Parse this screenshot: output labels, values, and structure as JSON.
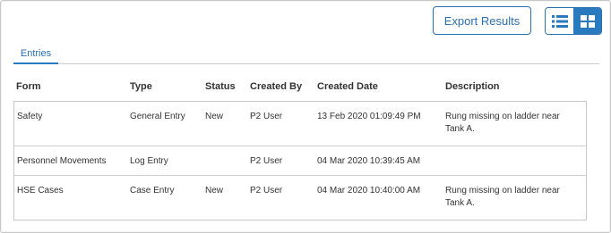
{
  "toolbar": {
    "export_label": "Export Results",
    "view_list_icon": "list-view-icon",
    "view_grid_icon": "grid-view-icon",
    "accent_color": "#2a7ac0"
  },
  "tabs": [
    {
      "label": "Entries",
      "active": true
    }
  ],
  "table": {
    "columns": [
      "Form",
      "Type",
      "Status",
      "Created By",
      "Created Date",
      "Description"
    ],
    "rows": [
      {
        "form": "Safety",
        "type": "General Entry",
        "status": "New",
        "created_by": "P2 User",
        "created_date": "13 Feb 2020 01:09:49 PM",
        "description": "Rung missing on ladder near Tank A."
      },
      {
        "form": "Personnel Movements",
        "type": "Log Entry",
        "status": "",
        "created_by": "P2 User",
        "created_date": "04 Mar 2020 10:39:45 AM",
        "description": ""
      },
      {
        "form": "HSE Cases",
        "type": "Case Entry",
        "status": "New",
        "created_by": "P2 User",
        "created_date": "04 Mar 2020 10:40:00 AM",
        "description": "Rung missing on ladder near Tank A."
      }
    ]
  }
}
